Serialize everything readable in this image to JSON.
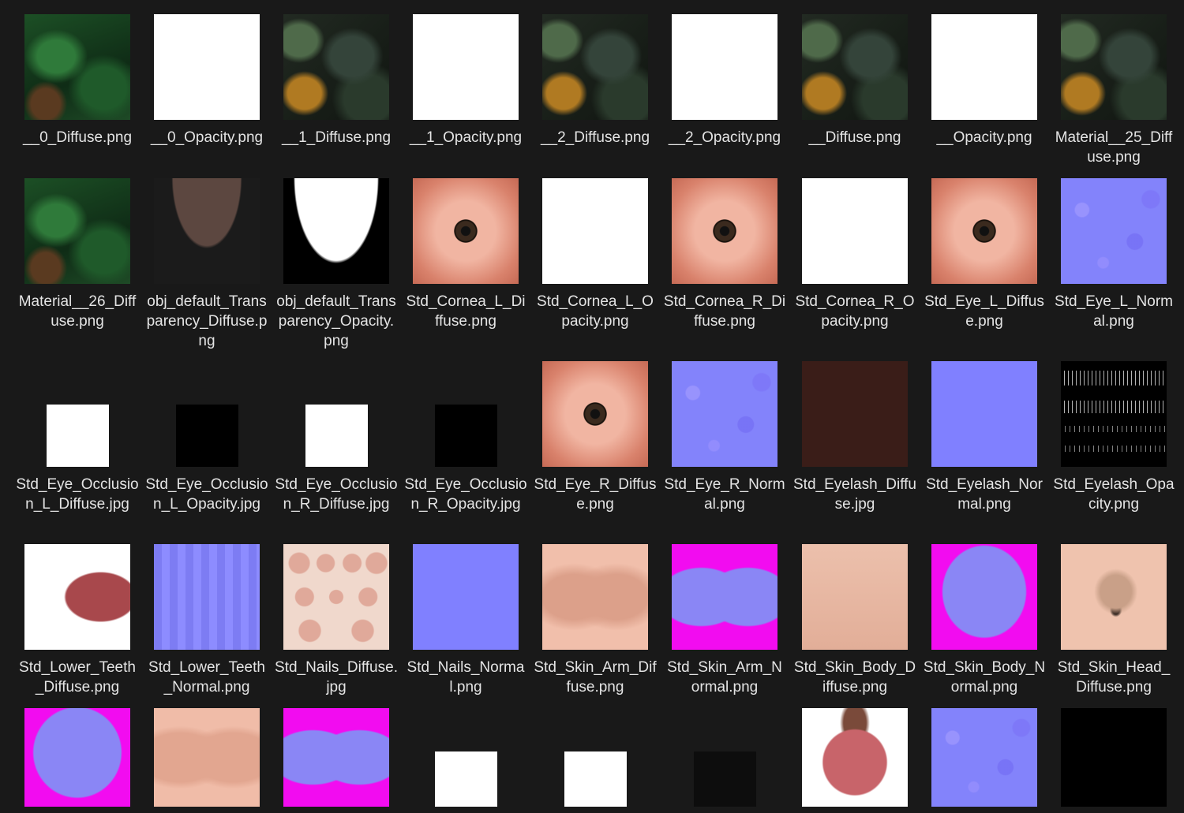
{
  "files": [
    {
      "name": "__0_Diffuse.png",
      "look": "green"
    },
    {
      "name": "__0_Opacity.png",
      "look": "white"
    },
    {
      "name": "__1_Diffuse.png",
      "look": "armor"
    },
    {
      "name": "__1_Opacity.png",
      "look": "white"
    },
    {
      "name": "__2_Diffuse.png",
      "look": "armor"
    },
    {
      "name": "__2_Opacity.png",
      "look": "white"
    },
    {
      "name": "__Diffuse.png",
      "look": "armor"
    },
    {
      "name": "__Opacity.png",
      "look": "white"
    },
    {
      "name": "Material__25_Diffuse.png",
      "look": "armor"
    },
    {
      "name": "Material__26_Diffuse.png",
      "look": "green"
    },
    {
      "name": "obj_default_Transparency_Diffuse.png",
      "look": "transp-diffuse"
    },
    {
      "name": "obj_default_Transparency_Opacity.png",
      "look": "transp-opacity"
    },
    {
      "name": "Std_Cornea_L_Diffuse.png",
      "look": "eye"
    },
    {
      "name": "Std_Cornea_L_Opacity.png",
      "look": "white"
    },
    {
      "name": "Std_Cornea_R_Diffuse.png",
      "look": "eye"
    },
    {
      "name": "Std_Cornea_R_Opacity.png",
      "look": "white"
    },
    {
      "name": "Std_Eye_L_Diffuse.png",
      "look": "eye"
    },
    {
      "name": "Std_Eye_L_Normal.png",
      "look": "normal-tex"
    },
    {
      "name": "Std_Eye_Occlusion_L_Diffuse.jpg",
      "look": "white",
      "small": true
    },
    {
      "name": "Std_Eye_Occlusion_L_Opacity.jpg",
      "look": "black",
      "small": true
    },
    {
      "name": "Std_Eye_Occlusion_R_Diffuse.jpg",
      "look": "white",
      "small": true
    },
    {
      "name": "Std_Eye_Occlusion_R_Opacity.jpg",
      "look": "black",
      "small": true
    },
    {
      "name": "Std_Eye_R_Diffuse.png",
      "look": "eye"
    },
    {
      "name": "Std_Eye_R_Normal.png",
      "look": "normal-tex"
    },
    {
      "name": "Std_Eyelash_Diffuse.jpg",
      "look": "brown"
    },
    {
      "name": "Std_Eyelash_Normal.png",
      "look": "normal"
    },
    {
      "name": "Std_Eyelash_Opacity.png",
      "look": "lashes"
    },
    {
      "name": "Std_Lower_Teeth_Diffuse.png",
      "look": "teeth"
    },
    {
      "name": "Std_Lower_Teeth_Normal.png",
      "look": "teeth-normal"
    },
    {
      "name": "Std_Nails_Diffuse.jpg",
      "look": "nails"
    },
    {
      "name": "Std_Nails_Normal.png",
      "look": "normal"
    },
    {
      "name": "Std_Skin_Arm_Diffuse.png",
      "look": "skinarm"
    },
    {
      "name": "Std_Skin_Arm_Normal.png",
      "look": "magenta-normal"
    },
    {
      "name": "Std_Skin_Body_Diffuse.png",
      "look": "skin"
    },
    {
      "name": "Std_Skin_Body_Normal.png",
      "look": "body-normal"
    },
    {
      "name": "Std_Skin_Head_Diffuse.png",
      "look": "head"
    },
    {
      "name": "",
      "look": "head-normal"
    },
    {
      "name": "",
      "look": "skinleg"
    },
    {
      "name": "",
      "look": "magenta-normal"
    },
    {
      "name": "",
      "look": "white",
      "small": true
    },
    {
      "name": "",
      "look": "white",
      "small": true
    },
    {
      "name": "",
      "look": "nearblack",
      "small": true
    },
    {
      "name": "",
      "look": "tongue"
    },
    {
      "name": "",
      "look": "normal-tex"
    },
    {
      "name": "",
      "look": "black"
    }
  ]
}
